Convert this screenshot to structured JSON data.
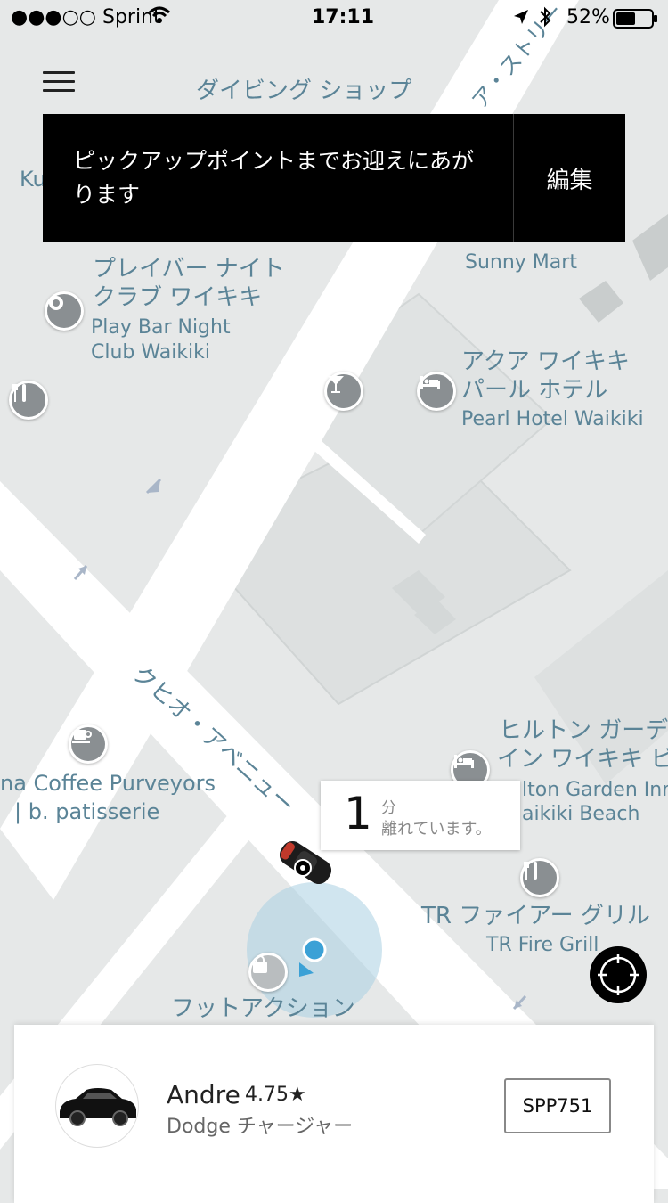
{
  "status_bar": {
    "carrier": "●●●○○ Sprint",
    "time": "17:11",
    "battery": "52%"
  },
  "banner": {
    "message": "ピックアップポイントまでお迎えにあがります",
    "edit_label": "編集"
  },
  "map": {
    "labels": {
      "diving_shop": "ダイビング ショップ",
      "street_top": "ア・ストリー",
      "ku": "Ku",
      "sunny_mart": "Sunny Mart",
      "playbar_jp_1": "プレイバー ナイト",
      "playbar_jp_2": "クラブ ワイキキ",
      "playbar_en_1": "Play Bar Night",
      "playbar_en_2": "Club Waikiki",
      "aqua_jp_1": "アクア ワイキキ",
      "aqua_jp_2": "パール ホテル",
      "aqua_en": "Pearl Hotel Waikiki",
      "kuhio_avenue": "クヒオ・アベニュー",
      "coffee_1": "na Coffee Purveyors",
      "coffee_2": "| b. patisserie",
      "hilton_jp_1": "ヒルトン ガーデ",
      "hilton_jp_2": "イン ワイキキ ビ",
      "hilton_en_1": "lton Garden Inn",
      "hilton_en_2": "aikiki Beach",
      "tr_jp": "TR ファイアー グリル",
      "tr_en": "TR Fire Grill",
      "footaction": "フットアクション"
    },
    "icons": [
      "circle-poi-icon",
      "fork-knife-icon",
      "cocktail-icon",
      "bed-icon",
      "coffee-cup-icon",
      "bed-icon",
      "fork-knife-icon",
      "shopping-bag-icon"
    ]
  },
  "eta": {
    "minutes": "1",
    "unit": "分",
    "text": "離れています。"
  },
  "driver": {
    "name": "Andre",
    "rating": "4.75★",
    "vehicle": "Dodge チャージャー",
    "plate": "SPP751"
  },
  "colors": {
    "map_bg": "#e6e8e8",
    "road": "#ffffff",
    "label": "#5b8497",
    "user_dot": "#3ba1d6",
    "banner_bg": "#000000"
  }
}
